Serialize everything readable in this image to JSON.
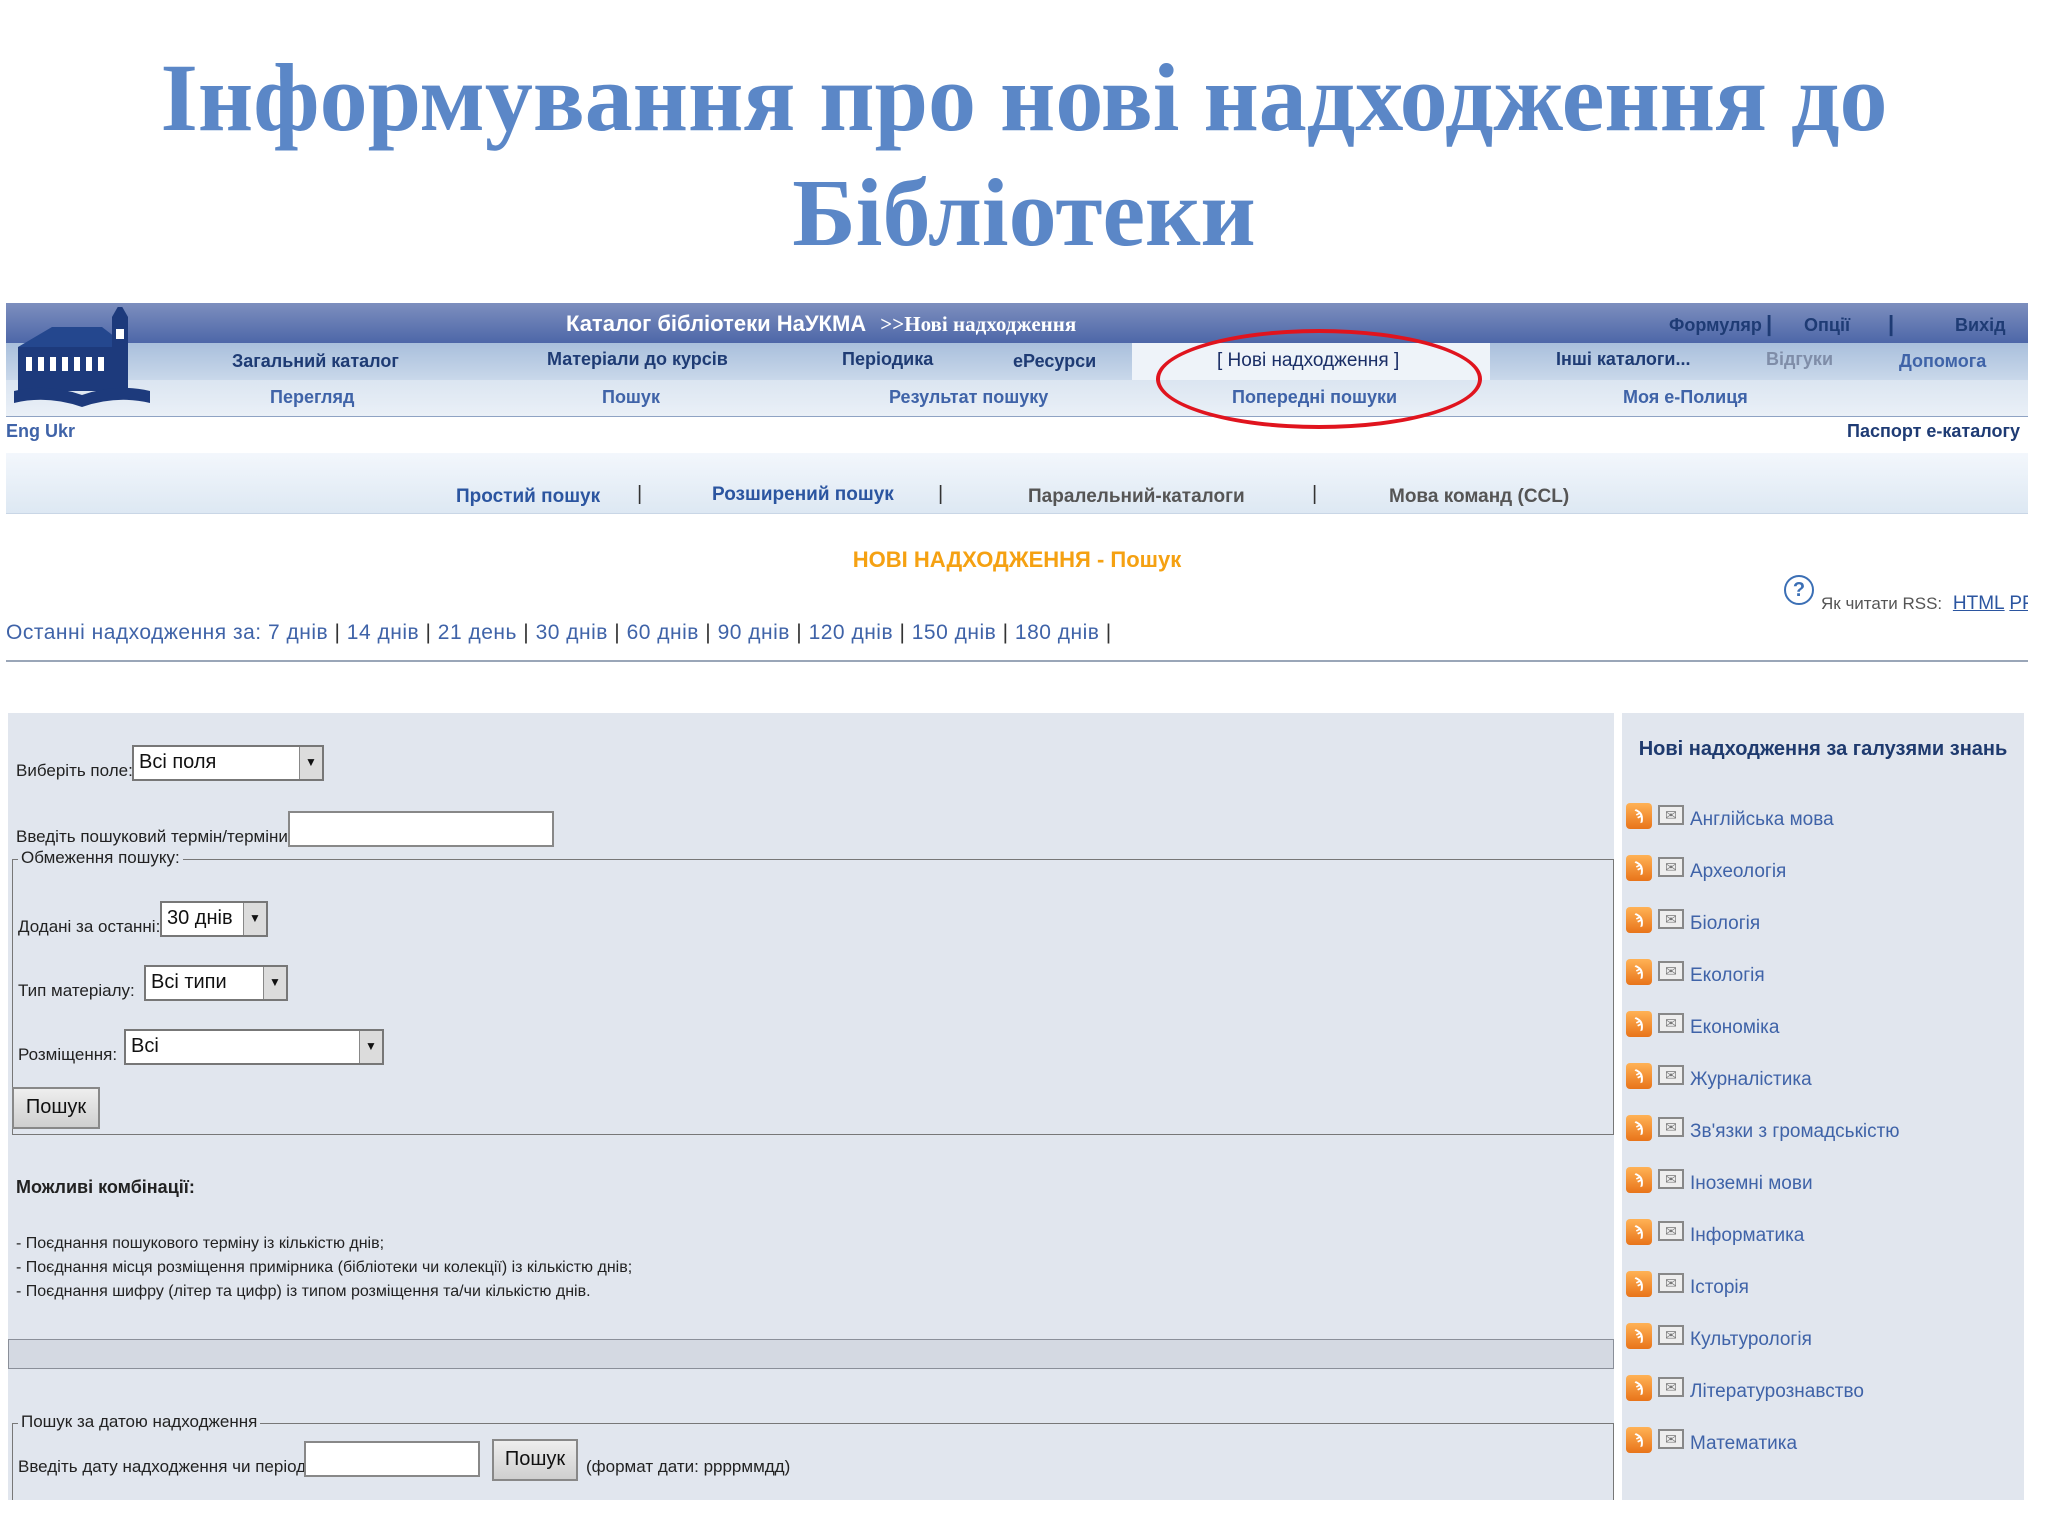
{
  "slide": {
    "title_line1": "Інформування про нові надходження до",
    "title_line2": "Бібліотеки"
  },
  "header": {
    "catalog_title": "Каталог бібліотеки НаУКМА",
    "breadcrumb": ">>Нові надходження",
    "top_links": [
      "Формуляр",
      "Опції",
      "Вихід"
    ],
    "row1": [
      "Загальний каталог",
      "Матеріали до курсів",
      "Періодика",
      "еРесурси",
      "[ Нові надходження ]",
      "Інші каталоги...",
      "Відгуки",
      "Допомога"
    ],
    "row2": [
      "Перегляд",
      "Пошук",
      "Результат пошуку",
      "Попередні пошуки",
      "Моя е-Полиця"
    ],
    "lang": "Eng Ukr",
    "passport": "Паспорт е-каталогу"
  },
  "search_tabs": [
    "Простий пошук",
    "Розширений пошук",
    "Паралельний-каталоги",
    "Мова команд (CCL)"
  ],
  "section_title": "НОВІ НАДХОДЖЕННЯ - Пошук",
  "rss": {
    "help_icon": "?",
    "label": "Як читати RSS:",
    "links": [
      "HTML",
      "PPS"
    ]
  },
  "recent": {
    "label": "Останні надходження за:",
    "periods": [
      "7 днів",
      "14 днів",
      "21 день",
      "30 днів",
      "60 днів",
      "90 днів",
      "120 днів",
      "150 днів",
      "180 днів"
    ]
  },
  "form": {
    "field_label": "Виберіть поле:",
    "field_value": "Всі поля",
    "term_label": "Введіть пошуковий термін/терміни:",
    "term_value": "",
    "limits_legend": "Обмеження пошуку:",
    "added_label": "Додані за останні:",
    "added_value": "30 днів",
    "type_label": "Тип матеріалу:",
    "type_value": "Всі типи",
    "location_label": "Розміщення:",
    "location_value": "Всі",
    "search_button": "Пошук",
    "combos_title": "Можливі комбінації:",
    "combos": [
      "- Поєднання пошукового терміну із кількістю днів;",
      "- Поєднання місця розміщення примірника (бібліотеки чи колекції) із кількістю днів;",
      "- Поєднання шифру (літер та цифр) із типом розміщення та/чи кількістю днів."
    ],
    "date_legend": "Пошук за датою надходження",
    "date_label": "Введіть дату надходження чи період:",
    "date_value": "",
    "date_button": "Пошук",
    "date_format": "(формат дати: ррррммдд)"
  },
  "sidebar": {
    "title": "Нові надходження за галузями знань",
    "rss_icon_glyph": "ϡ",
    "mail_icon_glyph": "✉",
    "items": [
      "Англійська мова",
      "Археологія",
      "Біологія",
      "Екологія",
      "Економіка",
      "Журналістика",
      "Зв'язки з громадськістю",
      "Іноземні мови",
      "Інформатика",
      "Історія",
      "Культурологія",
      "Літературознавство",
      "Математика"
    ]
  }
}
